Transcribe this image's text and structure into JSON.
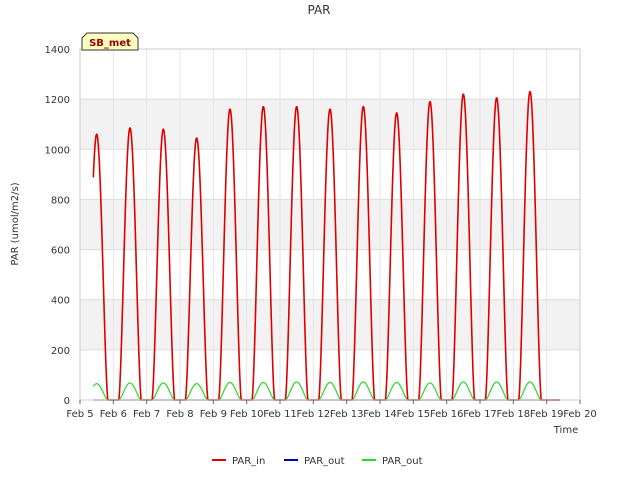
{
  "chart_data": {
    "type": "line",
    "title": "PAR",
    "xlabel": "Time",
    "ylabel": "PAR (umol/m2/s)",
    "annotation": "SB_met",
    "x_ticks": [
      "Feb 5",
      "Feb 6",
      "Feb 7",
      "Feb 8",
      "Feb 9",
      "Feb 10",
      "Feb 11",
      "Feb 12",
      "Feb 13",
      "Feb 14",
      "Feb 15",
      "Feb 16",
      "Feb 17",
      "Feb 18",
      "Feb 19",
      "Feb 20"
    ],
    "xlim": [
      5,
      20
    ],
    "y_ticks": [
      0,
      200,
      400,
      600,
      800,
      1000,
      1200,
      1400
    ],
    "ylim": [
      0,
      1400
    ],
    "grid": true,
    "legend_position": "bottom",
    "x_unit": "day of February",
    "day_peaks": {
      "days": [
        6,
        7,
        8,
        9,
        10,
        11,
        12,
        13,
        14,
        15,
        16,
        17,
        18,
        19
      ],
      "PAR_in_peak": [
        1060,
        1085,
        1080,
        1045,
        1160,
        1170,
        1170,
        1160,
        1170,
        1145,
        1190,
        1220,
        1205,
        1230
      ],
      "PAR_out_peak": [
        0,
        0,
        0,
        0,
        0,
        0,
        0,
        0,
        0,
        0,
        0,
        0,
        0,
        0
      ],
      "PAR_out_green_peak": [
        65,
        68,
        68,
        65,
        70,
        70,
        72,
        70,
        72,
        70,
        68,
        72,
        72,
        72
      ]
    },
    "series": [
      {
        "name": "PAR_in",
        "color": "#dd0000"
      },
      {
        "name": "PAR_out",
        "color": "#0000bb"
      },
      {
        "name": "PAR_out",
        "color": "#22dd22"
      }
    ]
  }
}
